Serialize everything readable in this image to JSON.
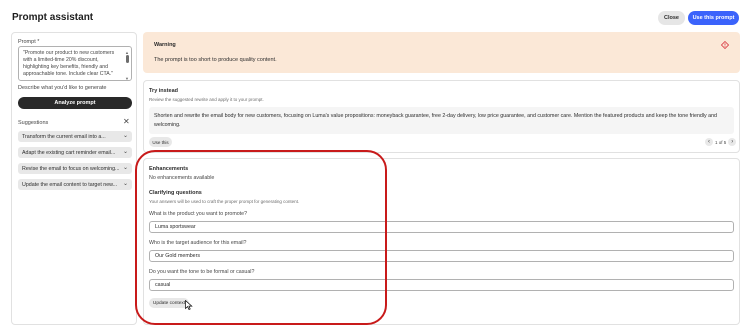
{
  "header": {
    "title": "Prompt assistant",
    "close_label": "Close",
    "use_prompt_label": "Use this prompt",
    "accent_color": "#3b63fb"
  },
  "left": {
    "prompt_label": "Prompt *",
    "prompt_value": "\"Promote our product to new customers with a limited-time 20% discount, highlighting key benefits, friendly and approachable tone. Include clear CTA.\"",
    "describe_label": "Describe what you'd like to generate",
    "analyze_label": "Analyze prompt",
    "suggestions_label": "Suggestions",
    "suggestions": [
      {
        "label": "Transform the current email into a..."
      },
      {
        "label": "Adapt the existing cart reminder email..."
      },
      {
        "label": "Revise the email to focus on welcoming..."
      },
      {
        "label": "Update the email content to target new..."
      }
    ]
  },
  "warning": {
    "title": "Warning",
    "text": "The prompt is too short to produce quality content.",
    "icon": "alert-diamond-icon",
    "color": "#fbe8d7"
  },
  "try_instead": {
    "title": "Try instead",
    "subtitle": "Review the suggested rewrite and apply it to your prompt.",
    "text": "Shorten and rewrite the email body for new customers, focusing on Luma's value propositions: moneyback guarantee, free 2-day delivery, low price guarantee, and customer care. Mention the featured products and keep the tone friendly and welcoming.",
    "use_label": "Use this",
    "pager": "1 of 5"
  },
  "enhancements": {
    "title": "Enhancements",
    "none_text": "No enhancements available",
    "clarify_title": "Clarifying questions",
    "clarify_sub": "Your answers will be used to craft the proper prompt for generating content.",
    "questions": [
      {
        "label": "What is the product you want to promote?",
        "value": "Luma sportswear"
      },
      {
        "label": "Who is the target audience for this email?",
        "value": "Our Gold members"
      },
      {
        "label": "Do you want the tone to be formal or casual?",
        "value": "casual"
      }
    ],
    "update_label": "Update context",
    "highlight_color": "#c81a1a"
  }
}
